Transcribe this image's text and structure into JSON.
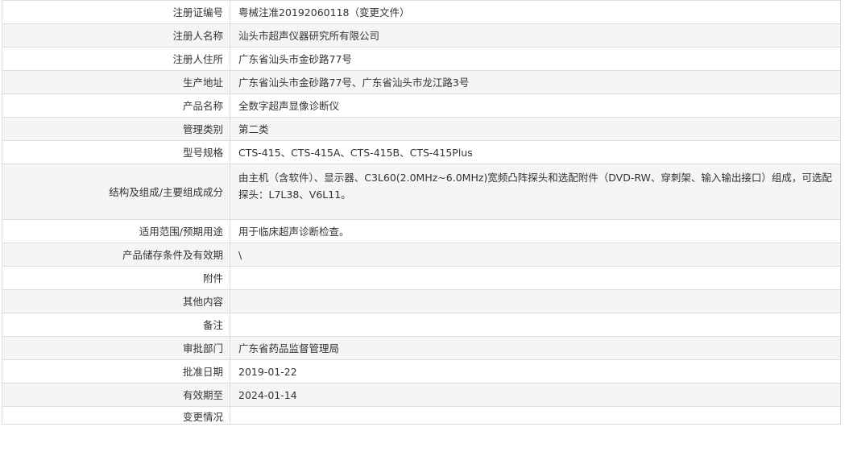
{
  "rows": [
    {
      "label": "注册证编号",
      "value": "粤械注准20192060118（变更文件）"
    },
    {
      "label": "注册人名称",
      "value": "汕头市超声仪器研究所有限公司"
    },
    {
      "label": "注册人住所",
      "value": "广东省汕头市金砂路77号"
    },
    {
      "label": "生产地址",
      "value": "广东省汕头市金砂路77号、广东省汕头市龙江路3号"
    },
    {
      "label": "产品名称",
      "value": "全数字超声显像诊断仪"
    },
    {
      "label": "管理类别",
      "value": "第二类"
    },
    {
      "label": "型号规格",
      "value": "CTS-415、CTS-415A、CTS-415B、CTS-415Plus"
    },
    {
      "label": "结构及组成/主要组成成分",
      "value": "由主机（含软件）、显示器、C3L60(2.0MHz~6.0MHz)宽频凸阵探头和选配附件（DVD-RW、穿刺架、输入输出接口）组成，可选配探头：L7L38、V6L11。"
    },
    {
      "label": "适用范围/预期用途",
      "value": "用于临床超声诊断检查。"
    },
    {
      "label": "产品储存条件及有效期",
      "value": "\\"
    },
    {
      "label": "附件",
      "value": ""
    },
    {
      "label": "其他内容",
      "value": ""
    },
    {
      "label": "备注",
      "value": ""
    },
    {
      "label": "审批部门",
      "value": "广东省药品监督管理局"
    },
    {
      "label": "批准日期",
      "value": "2019-01-22"
    },
    {
      "label": "有效期至",
      "value": "2024-01-14"
    },
    {
      "label": "变更情况",
      "value": ""
    }
  ]
}
